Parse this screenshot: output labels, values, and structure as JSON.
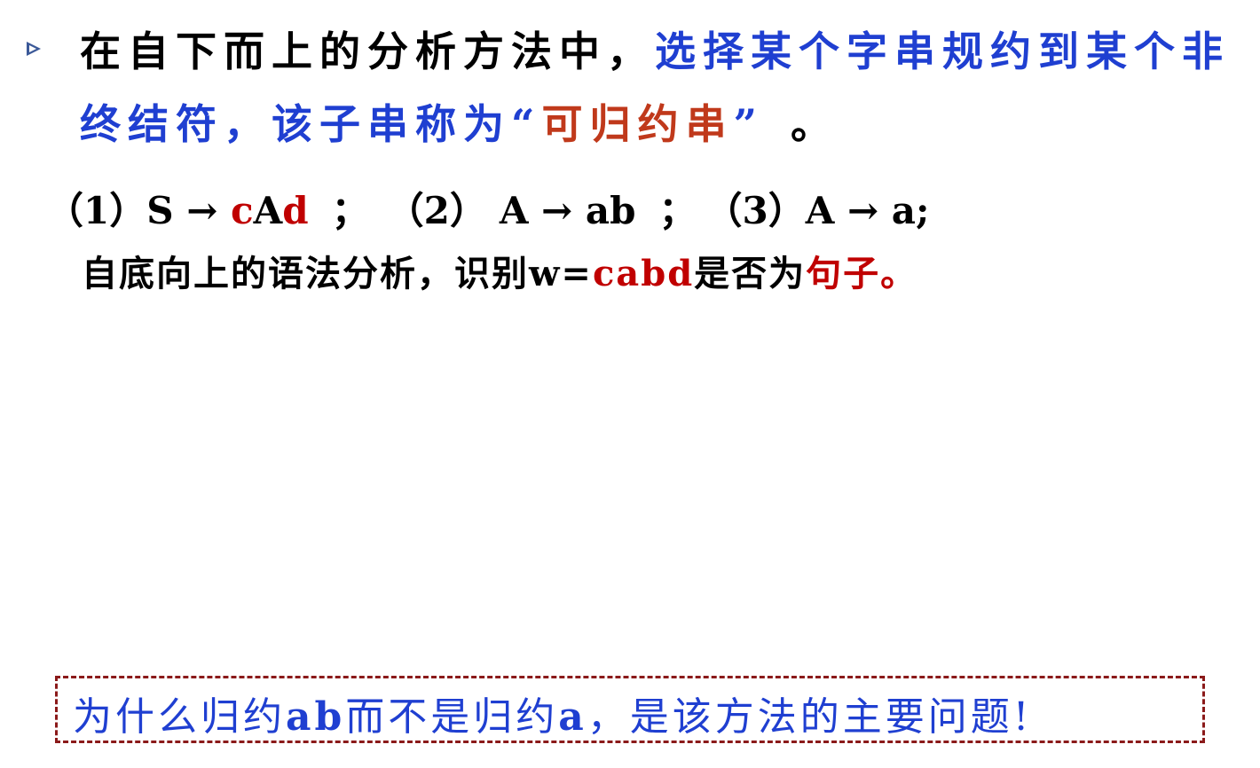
{
  "slide": {
    "bullet": {
      "line1_black": "在自下而上的分析方法中，",
      "line1_blue": "选择某个字串规约到某个非",
      "line2_blue_a": "终结符，该子串称为“",
      "line2_orange": "可归约串",
      "line2_blue_b": "”",
      "line2_black_end": "。"
    },
    "grammar": {
      "p1_num": "（1）",
      "p1_head": "S",
      "arrow": "→",
      "p1_body_c": "c",
      "p1_body_A": "A",
      "p1_body_d": "d",
      "sep": "；",
      "p2_num": "（2）",
      "p2_head": "A",
      "p2_body": "ab",
      "p3_num": "（3）",
      "p3_head": "A",
      "p3_body": "a;"
    },
    "task": {
      "text_a": "自底向上的语法分析，识别",
      "w_eq": "w=",
      "w_value": "cabd",
      "text_b": "是否为",
      "text_red": "句子。"
    },
    "callout": {
      "part1": "为什么归约",
      "ab": "ab",
      "part2": "而不是归约",
      "a": "a",
      "part3": "，是该方法的主要问题!"
    },
    "colors": {
      "blue": "#1f3fd1",
      "orange": "#c0391b",
      "red": "#c00000",
      "box_border": "#8b1a1a",
      "bullet": "#3b5998"
    }
  }
}
